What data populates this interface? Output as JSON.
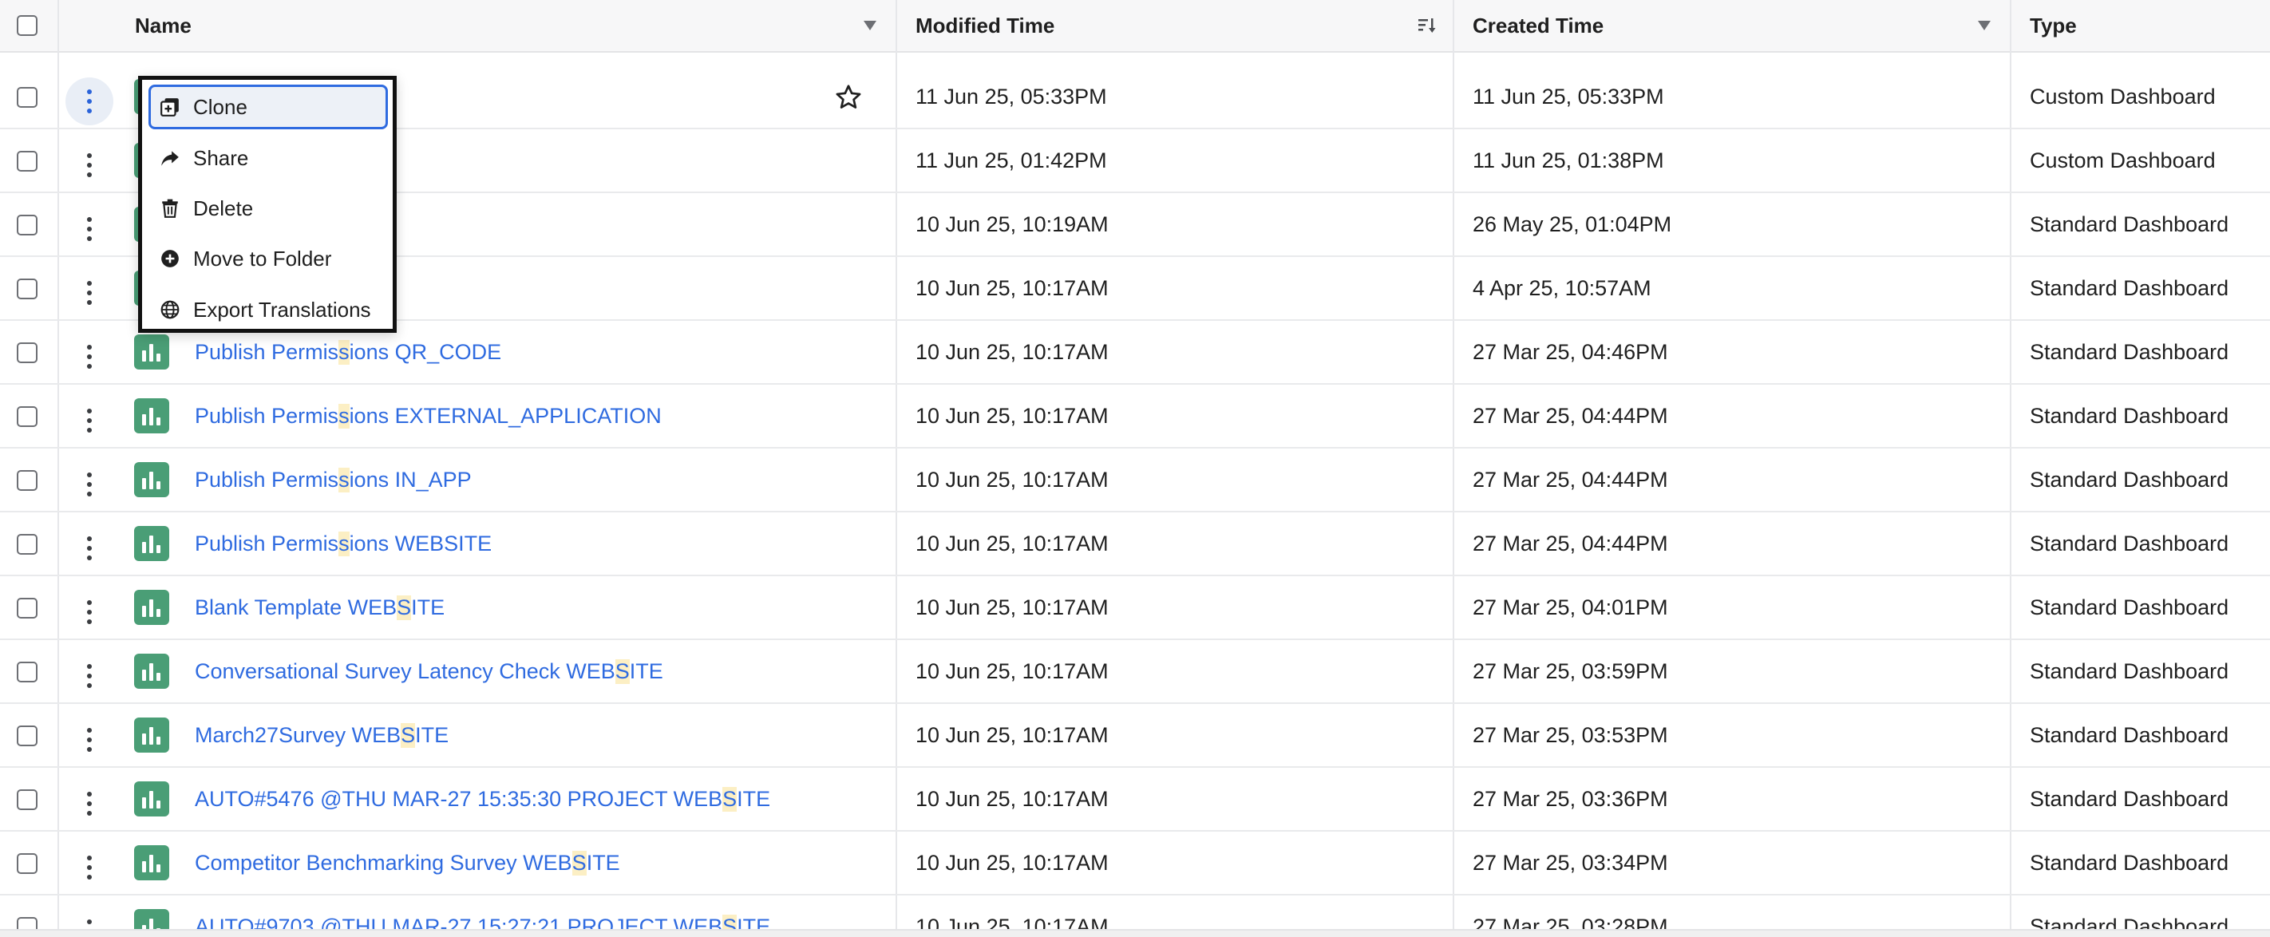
{
  "header": {
    "name_label": "Name",
    "modified_label": "Modified Time",
    "created_label": "Created Time",
    "type_label": "Type"
  },
  "context_menu": {
    "items": [
      {
        "label": "Clone",
        "icon": "clone-icon"
      },
      {
        "label": "Share",
        "icon": "share-icon"
      },
      {
        "label": "Delete",
        "icon": "trash-icon"
      },
      {
        "label": "Move to Folder",
        "icon": "plus-circle-icon"
      },
      {
        "label": "Export Translations",
        "icon": "globe-icon"
      }
    ]
  },
  "rows": [
    {
      "name_pre": "",
      "name_hl": "",
      "name_post": "",
      "modified": "11 Jun 25, 05:33PM",
      "created": "11 Jun 25, 05:33PM",
      "type": "Custom Dashboard"
    },
    {
      "name_pre": "",
      "name_hl": "",
      "name_post": "",
      "modified": "11 Jun 25, 01:42PM",
      "created": "11 Jun 25, 01:38PM",
      "type": "Custom Dashboard"
    },
    {
      "name_pre": "",
      "name_hl": "",
      "name_post": "",
      "modified": "10 Jun 25, 10:19AM",
      "created": "26 May 25, 01:04PM",
      "type": "Standard Dashboard"
    },
    {
      "name_pre": "",
      "name_hl": "",
      "name_post": "",
      "modified": "10 Jun 25, 10:17AM",
      "created": "4 Apr 25, 10:57AM",
      "type": "Standard Dashboard"
    },
    {
      "name_pre": "Publish Permis",
      "name_hl": "s",
      "name_post": "ions QR_CODE",
      "modified": "10 Jun 25, 10:17AM",
      "created": "27 Mar 25, 04:46PM",
      "type": "Standard Dashboard"
    },
    {
      "name_pre": "Publish Permis",
      "name_hl": "s",
      "name_post": "ions EXTERNAL_APPLICATION",
      "modified": "10 Jun 25, 10:17AM",
      "created": "27 Mar 25, 04:44PM",
      "type": "Standard Dashboard"
    },
    {
      "name_pre": "Publish Permis",
      "name_hl": "s",
      "name_post": "ions IN_APP",
      "modified": "10 Jun 25, 10:17AM",
      "created": "27 Mar 25, 04:44PM",
      "type": "Standard Dashboard"
    },
    {
      "name_pre": "Publish Permis",
      "name_hl": "s",
      "name_post": "ions WEBSITE",
      "modified": "10 Jun 25, 10:17AM",
      "created": "27 Mar 25, 04:44PM",
      "type": "Standard Dashboard"
    },
    {
      "name_pre": "Blank Template WEB",
      "name_hl": "S",
      "name_post": "ITE",
      "modified": "10 Jun 25, 10:17AM",
      "created": "27 Mar 25, 04:01PM",
      "type": "Standard Dashboard"
    },
    {
      "name_pre": "Conversational Survey Latency Check WEB",
      "name_hl": "S",
      "name_post": "ITE",
      "modified": "10 Jun 25, 10:17AM",
      "created": "27 Mar 25, 03:59PM",
      "type": "Standard Dashboard"
    },
    {
      "name_pre": "March27Survey WEB",
      "name_hl": "S",
      "name_post": "ITE",
      "modified": "10 Jun 25, 10:17AM",
      "created": "27 Mar 25, 03:53PM",
      "type": "Standard Dashboard"
    },
    {
      "name_pre": "AUTO#5476 @THU MAR-27 15:35:30 PROJECT WEB",
      "name_hl": "S",
      "name_post": "ITE",
      "modified": "10 Jun 25, 10:17AM",
      "created": "27 Mar 25, 03:36PM",
      "type": "Standard Dashboard"
    },
    {
      "name_pre": "Competitor Benchmarking Survey WEB",
      "name_hl": "S",
      "name_post": "ITE",
      "modified": "10 Jun 25, 10:17AM",
      "created": "27 Mar 25, 03:34PM",
      "type": "Standard Dashboard"
    },
    {
      "name_pre": "AUTO#9703 @THU MAR-27 15:27:21 PROJECT WEB",
      "name_hl": "S",
      "name_post": "ITE",
      "modified": "10 Jun 25, 10:17AM",
      "created": "27 Mar 25, 03:28PM",
      "type": "Standard Dashboard"
    }
  ]
}
